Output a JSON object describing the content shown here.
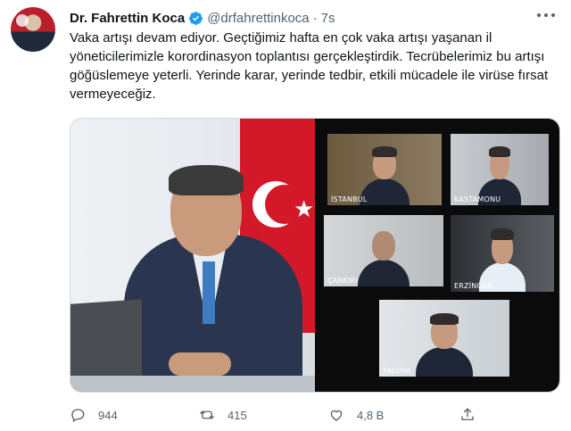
{
  "tweet": {
    "author_name": "Dr. Fahrettin Koca",
    "handle": "@drfahrettinkoca",
    "separator": "·",
    "time": "7s",
    "text": "Vaka artışı devam ediyor. Geçtiğimiz hafta en çok vaka artışı yaşanan il yöneticilerimizle korordinasyon toplantısı gerçekleştirdik. Tecrübelerimiz bu artışı göğüslemeye yeterli. Yerinde karar, yerinde tedbir, etkili mücadele ile virüse fırsat vermeyeceğiz."
  },
  "media": {
    "video_tiles": [
      {
        "label": "İSTANBUL"
      },
      {
        "label": "KASTAMONU"
      },
      {
        "label": "ÇANKIRI"
      },
      {
        "label": "ERZİNCAN"
      },
      {
        "label": "YALOVA"
      }
    ]
  },
  "actions": {
    "reply_count": "944",
    "retweet_count": "415",
    "like_count": "4,8 B"
  },
  "colors": {
    "text_primary": "#0f1419",
    "text_secondary": "#536471",
    "verified_blue": "#1d9bf0",
    "border": "#cfd9de",
    "flag_red": "#d3182a"
  },
  "icons": [
    "more-icon",
    "verified-badge-icon",
    "reply-icon",
    "retweet-icon",
    "like-icon",
    "share-icon"
  ]
}
